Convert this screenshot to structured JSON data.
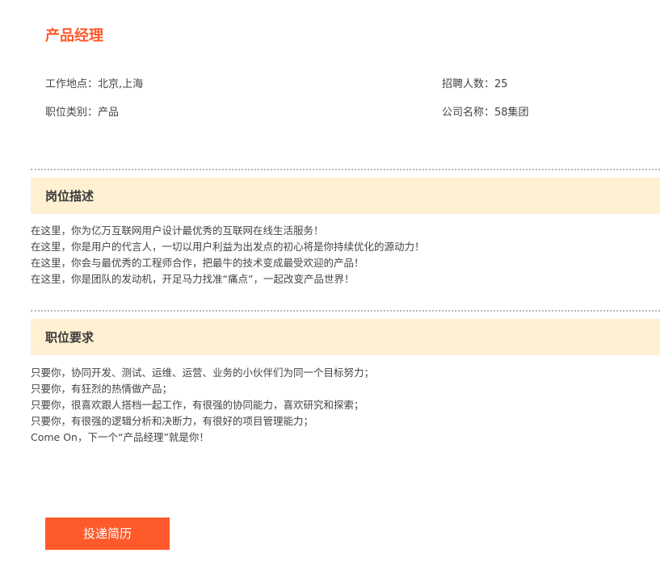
{
  "job": {
    "title": "产品经理",
    "location": "工作地点：北京,上海",
    "headcount": "招聘人数：25",
    "category": "职位类别：产品",
    "company": "公司名称：58集团"
  },
  "description": {
    "heading": "岗位描述",
    "lines": [
      "在这里，你为亿万互联网用户设计最优秀的互联网在线生活服务！",
      "在这里，你是用户的代言人，一切以用户利益为出发点的初心将是你持续优化的源动力！",
      "在这里，你会与最优秀的工程师合作，把最牛的技术变成最受欢迎的产品！",
      "在这里，你是团队的发动机，开足马力找准“痛点”，一起改变产品世界！"
    ]
  },
  "requirements": {
    "heading": "职位要求",
    "lines": [
      "只要你，协同开发、测试、运维、运营、业务的小伙伴们为同一个目标努力；",
      "只要你，有狂烈的热情做产品；",
      "只要你，很喜欢跟人搭档一起工作，有很强的协同能力，喜欢研究和探索；",
      "只要你，有很强的逻辑分析和决断力，有很好的项目管理能力；",
      "Come On，下一个“产品经理”就是你！"
    ]
  },
  "actions": {
    "apply_label": "投递简历"
  },
  "colors": {
    "accent": "#ff5a2b",
    "section_bg": "#fff0d2"
  }
}
